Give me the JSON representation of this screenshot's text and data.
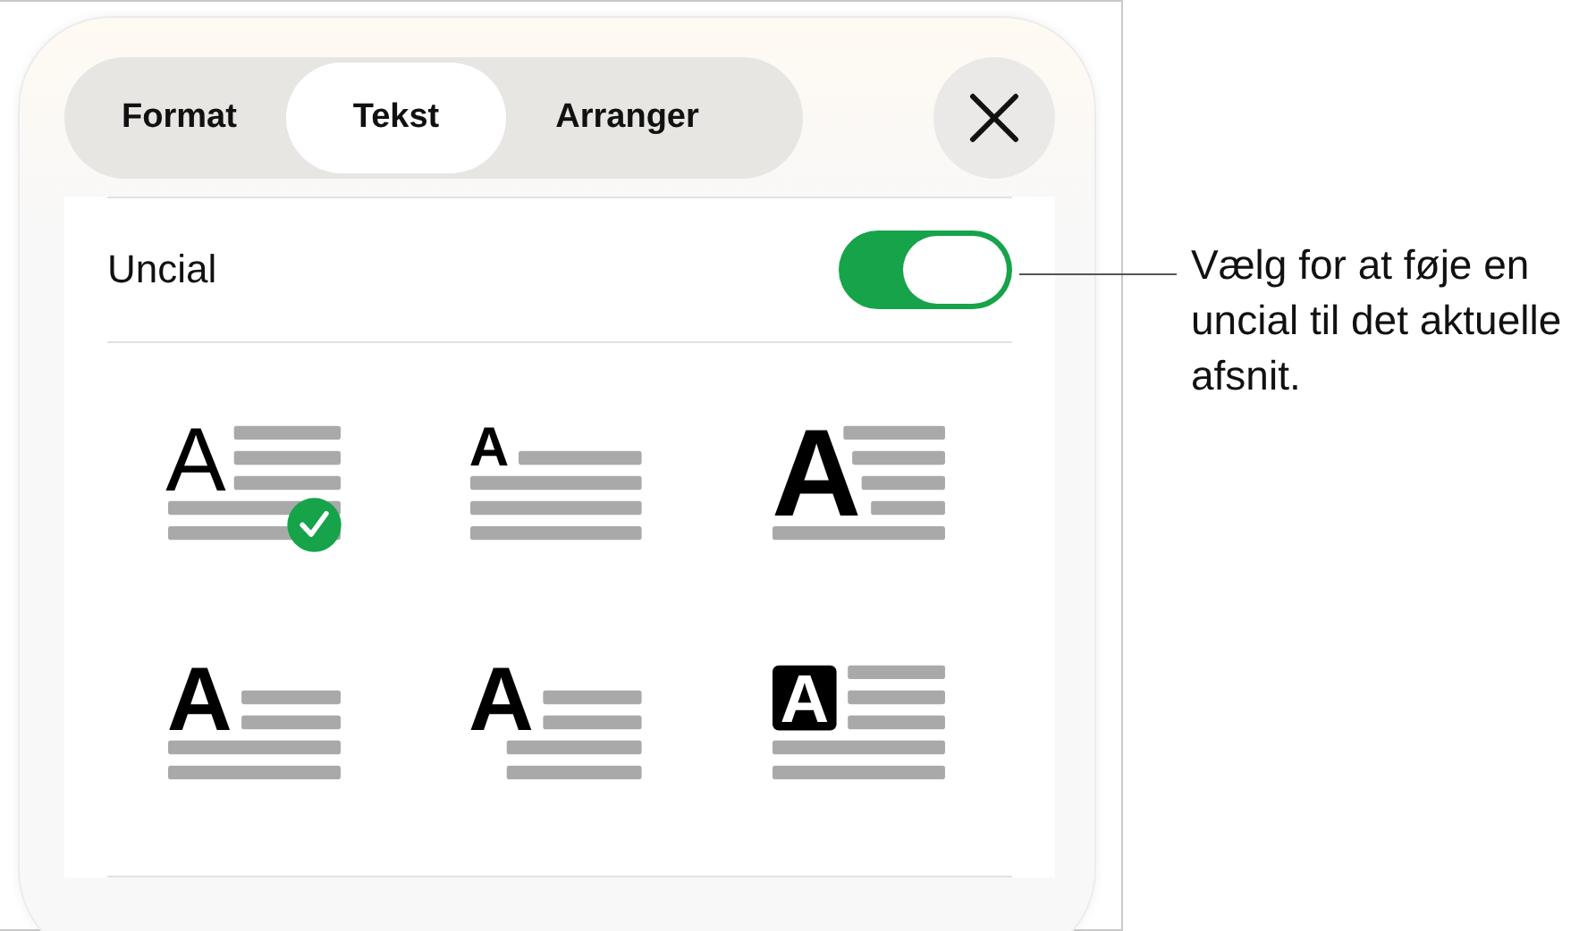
{
  "tabs": [
    {
      "label": "Format",
      "selected": false
    },
    {
      "label": "Tekst",
      "selected": true
    },
    {
      "label": "Arranger",
      "selected": false
    }
  ],
  "uncial": {
    "label": "Uncial",
    "on": true
  },
  "styles": [
    {
      "kind": "thin",
      "letter": "A",
      "selected": true
    },
    {
      "kind": "small",
      "letter": "A",
      "selected": false
    },
    {
      "kind": "large",
      "letter": "A",
      "selected": false
    },
    {
      "kind": "bold",
      "letter": "A",
      "selected": false
    },
    {
      "kind": "hanging",
      "letter": "A",
      "selected": false
    },
    {
      "kind": "boxed",
      "letter": "A",
      "selected": false
    }
  ],
  "callout": "Vælg for at føje en uncial til det aktuelle afsnit."
}
